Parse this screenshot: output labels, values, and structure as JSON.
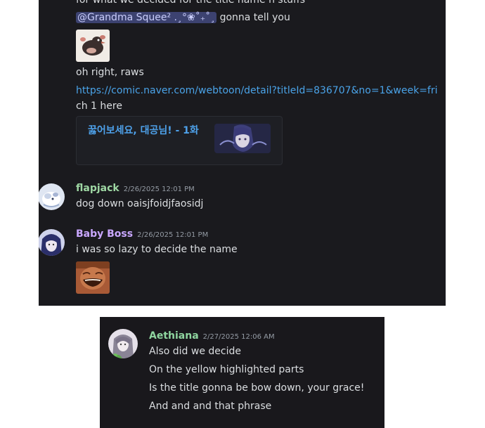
{
  "panel1": {
    "cut_line": "for what we decided for the title name n stuffs",
    "mention": "@Grandma Squee² .¸°❀˚₊˚¸",
    "mention_suffix": " gonna tell you",
    "line_raws": "oh right, raws",
    "link_line1": "https://comic.naver.com/webtoon/detail?titleId=836707&no=1&week=fri",
    "link_line2": "ch 1 here",
    "embed_title": "꿇어보세요, 대공님! - 1화",
    "messages": [
      {
        "username": "flapjack",
        "timestamp": "2/26/2025 12:01 PM",
        "text": "dog down oaisjfoidjfaosidj",
        "name_color": "#9ed7a3"
      },
      {
        "username": "Baby Boss",
        "timestamp": "2/26/2025 12:01 PM",
        "text": "i was so lazy to decide the name",
        "name_color": "#c9a7ff"
      }
    ]
  },
  "panel2": {
    "username": "Aethiana",
    "timestamp": "2/27/2025 12:06 AM",
    "name_color": "#8fd6a0",
    "lines": [
      "Also did we decide",
      "On the yellow highlighted parts",
      "Is the title gonna be bow down, your grace!",
      "And and and that phrase"
    ]
  }
}
